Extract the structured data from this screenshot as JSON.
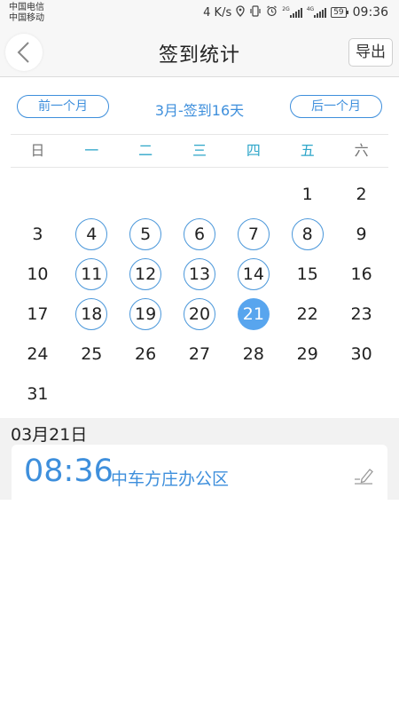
{
  "status_bar": {
    "carrier_1": "中国电信",
    "carrier_2": "中国移动",
    "speed": "4 K/s",
    "battery": "59",
    "time": "09:36",
    "net_tag_1": "2G",
    "net_tag_2": "4G"
  },
  "header": {
    "title": "签到统计",
    "export_label": "导出"
  },
  "month_nav": {
    "prev_label": "前一个月",
    "month_label": "3月-签到16天",
    "next_label": "后一个月"
  },
  "weekdays": [
    "日",
    "一",
    "二",
    "三",
    "四",
    "五",
    "六"
  ],
  "calendar": {
    "weeks": [
      [
        "",
        "",
        "",
        "",
        "",
        "1",
        "2"
      ],
      [
        "3",
        "4",
        "5",
        "6",
        "7",
        "8",
        "9"
      ],
      [
        "10",
        "11",
        "12",
        "13",
        "14",
        "15",
        "16"
      ],
      [
        "17",
        "18",
        "19",
        "20",
        "21",
        "22",
        "23"
      ],
      [
        "24",
        "25",
        "26",
        "27",
        "28",
        "29",
        "30"
      ],
      [
        "31",
        "",
        "",
        "",
        "",
        "",
        ""
      ]
    ],
    "checked_in_days": [
      "4",
      "5",
      "6",
      "7",
      "8",
      "11",
      "12",
      "13",
      "14",
      "18",
      "19",
      "20",
      "21"
    ],
    "selected_day": "21"
  },
  "detail": {
    "date": "03月21日",
    "record_time": "08:36",
    "record_place": "中车方庄办公区"
  },
  "colors": {
    "accent": "#3e8fdc",
    "weekday_header": "#2ea6c9",
    "selected_day_fill": "#58a5ee"
  }
}
